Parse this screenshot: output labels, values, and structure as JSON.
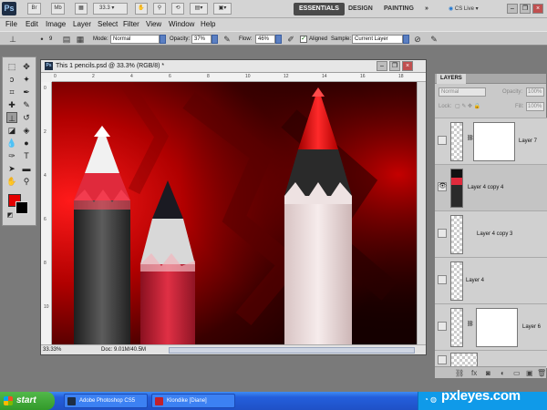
{
  "appbar": {
    "logo": "Ps",
    "zoom": "33.3",
    "workspaces": [
      "ESSENTIALS",
      "DESIGN",
      "PAINTING"
    ],
    "more": "»",
    "cs_live": "CS Live",
    "buttons": [
      "Br",
      "Mb"
    ]
  },
  "menu": [
    "File",
    "Edit",
    "Image",
    "Layer",
    "Select",
    "Filter",
    "View",
    "Window",
    "Help"
  ],
  "options": {
    "brush_size": "9",
    "mode_label": "Mode:",
    "mode_value": "Normal",
    "opacity_label": "Opacity:",
    "opacity_value": "37%",
    "flow_label": "Flow:",
    "flow_value": "46%",
    "aligned_label": "Aligned",
    "sample_label": "Sample:",
    "sample_value": "Current Layer"
  },
  "document": {
    "title": "This 1 pencils.psd @ 33.3% (RGB/8) *",
    "zoom": "33.33%",
    "doc_size": "Doc: 9.01M/40.5M",
    "ruler_h": [
      "0",
      "2",
      "4",
      "6",
      "8",
      "10",
      "12",
      "14",
      "16",
      "18"
    ],
    "ruler_v": [
      "0",
      "2",
      "4",
      "6",
      "8",
      "10"
    ]
  },
  "layers": {
    "tab": "LAYERS",
    "blend_mode": "Normal",
    "opacity_label": "Opacity:",
    "opacity_value": "100%",
    "lock_label": "Lock:",
    "fill_label": "Fill:",
    "fill_value": "100%",
    "items": [
      {
        "name": "Layer 7"
      },
      {
        "name": "Layer 4 copy 4"
      },
      {
        "name": "Layer 4 copy 3"
      },
      {
        "name": "Layer 4"
      },
      {
        "name": "Layer 6"
      }
    ]
  },
  "taskbar": {
    "start": "start",
    "items": [
      "Adobe Photoshop CS5",
      "Klondike [Diane]"
    ]
  },
  "brand": "pxleyes.com"
}
